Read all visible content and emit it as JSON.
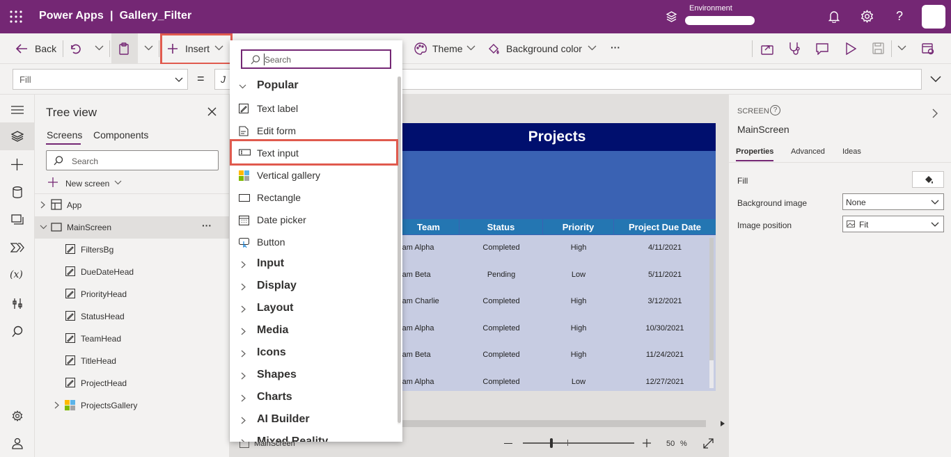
{
  "app": {
    "title": "Power Apps  |  Gallery_Filter",
    "environment_label": "Environment"
  },
  "toolbar": {
    "back_label": "Back",
    "insert_label": "Insert",
    "theme_label": "Theme",
    "background_color_label": "Background color",
    "more_label": "···"
  },
  "formula": {
    "property": "Fill",
    "equals": "=",
    "value_prefix": "J"
  },
  "tree": {
    "title": "Tree view",
    "tabs": [
      "Screens",
      "Components"
    ],
    "search_placeholder": "Search",
    "new_screen_label": "New screen",
    "app_label": "App",
    "screen_label": "MainScreen",
    "items": [
      "FiltersBg",
      "DueDateHead",
      "PriorityHead",
      "StatusHead",
      "TeamHead",
      "TitleHead",
      "ProjectHead",
      "ProjectsGallery"
    ]
  },
  "insert_menu": {
    "search_placeholder": "Search",
    "popular_label": "Popular",
    "items": [
      "Text label",
      "Edit form",
      "Text input",
      "Vertical gallery",
      "Rectangle",
      "Date picker",
      "Button"
    ],
    "categories": [
      "Input",
      "Display",
      "Layout",
      "Media",
      "Icons",
      "Shapes",
      "Charts",
      "AI Builder",
      "Mixed Reality"
    ]
  },
  "canvas": {
    "header_title": "Projects",
    "columns": [
      "Team",
      "Status",
      "Priority",
      "Project Due Date"
    ],
    "rows": [
      [
        "Team Alpha",
        "Completed",
        "High",
        "4/11/2021"
      ],
      [
        "Team Beta",
        "Pending",
        "Low",
        "5/11/2021"
      ],
      [
        "Team Charlie",
        "Completed",
        "High",
        "3/12/2021"
      ],
      [
        "Team Alpha",
        "Completed",
        "High",
        "10/30/2021"
      ],
      [
        "Team Beta",
        "Completed",
        "High",
        "11/24/2021"
      ],
      [
        "Team Alpha",
        "Completed",
        "Low",
        "12/27/2021"
      ]
    ],
    "footer_screen_label": "MainScreen",
    "zoom_value": "50",
    "zoom_unit": "%"
  },
  "properties": {
    "section_label": "SCREEN",
    "screen_name": "MainScreen",
    "tabs": [
      "Properties",
      "Advanced",
      "Ideas"
    ],
    "fill_label": "Fill",
    "background_image_label": "Background image",
    "background_image_value": "None",
    "image_position_label": "Image position",
    "image_position_value": "Fit"
  },
  "colors": {
    "brand": "#742774",
    "screen_header": "#000f6e",
    "screen_body": "#3a62b3",
    "column_header": "#2476b2",
    "gallery_bg": "#c7cce2",
    "highlight": "#e05a4e"
  }
}
